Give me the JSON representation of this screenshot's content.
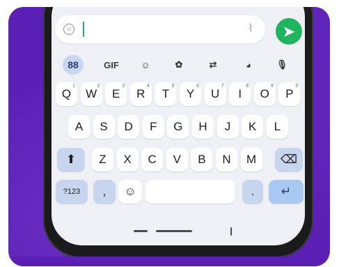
{
  "colors": {
    "background": "#5b1fb4",
    "send_button": "#1fb45e",
    "cursor": "#29a872",
    "modifier_key": "#c7d5ef",
    "enter_key": "#a8c8f2"
  },
  "message_bar": {
    "emoji_icon": "emoji-icon",
    "attach_icon": "paperclip-icon",
    "send_icon": "send-icon",
    "send_glyph": "➤"
  },
  "keyboard": {
    "toolbar": [
      {
        "name": "apps-icon",
        "glyph": "88"
      },
      {
        "name": "gif-button",
        "glyph": "GIF"
      },
      {
        "name": "sticker-icon",
        "glyph": "☺"
      },
      {
        "name": "settings-icon",
        "glyph": "✿"
      },
      {
        "name": "translate-icon",
        "glyph": "⇄"
      },
      {
        "name": "palette-icon",
        "glyph": "◕"
      },
      {
        "name": "mic-icon",
        "glyph": "🎙"
      }
    ],
    "row1": [
      {
        "label": "Q",
        "hint": "1"
      },
      {
        "label": "W",
        "hint": "2"
      },
      {
        "label": "E",
        "hint": "3"
      },
      {
        "label": "R",
        "hint": "4"
      },
      {
        "label": "T",
        "hint": "5"
      },
      {
        "label": "Y",
        "hint": "6"
      },
      {
        "label": "U",
        "hint": "7"
      },
      {
        "label": "I",
        "hint": "8"
      },
      {
        "label": "O",
        "hint": "9"
      },
      {
        "label": "P",
        "hint": "0"
      }
    ],
    "row2": [
      "A",
      "S",
      "D",
      "F",
      "G",
      "H",
      "J",
      "K",
      "L"
    ],
    "row3": [
      "Z",
      "X",
      "C",
      "V",
      "B",
      "N",
      "M"
    ],
    "shift_glyph": "⬆",
    "backspace_glyph": "⌫",
    "symbols_label": "?123",
    "comma_label": ",",
    "emoji_key_glyph": "☺",
    "period_label": ".",
    "enter_glyph": "↵"
  }
}
